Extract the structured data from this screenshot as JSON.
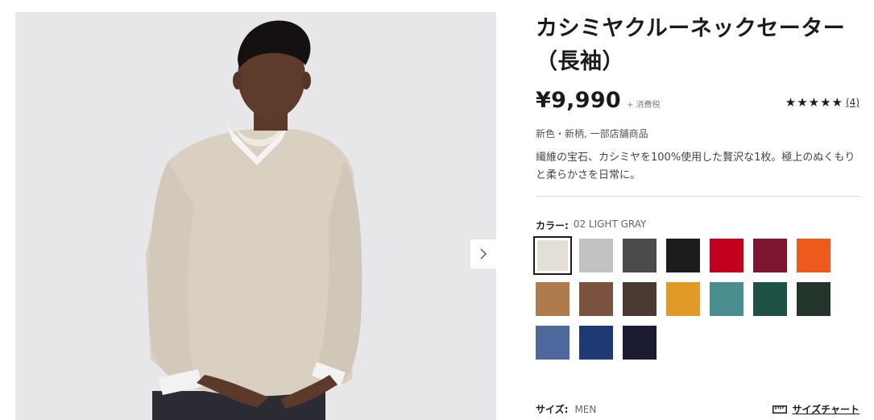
{
  "product": {
    "title": "カシミヤクルーネックセーター（長袖）",
    "price": "¥9,990",
    "tax_note": "+ 消費税",
    "rating_stars": "★★★★★",
    "review_count": "(4)",
    "tags": "新色・新柄, 一部店舗商品",
    "description": "繊維の宝石、カシミヤを100%使用した贅沢な1枚。極上のぬくもりと柔らかさを日常に。"
  },
  "gallery": {
    "next_icon": "chevron-right-icon",
    "background": "#e6e6e8"
  },
  "color": {
    "label": "カラー:",
    "selected": "02 LIGHT GRAY",
    "swatches": [
      {
        "color": "#e3dfd8"
      },
      {
        "color": "#c2c2c2"
      },
      {
        "color": "#4b4b4b"
      },
      {
        "color": "#1d1b1b"
      },
      {
        "color": "#c1001e"
      },
      {
        "color": "#7e1530"
      },
      {
        "color": "#ec5b1d"
      },
      {
        "color": "#b07b4c"
      },
      {
        "color": "#7b5240"
      },
      {
        "color": "#4a3a31"
      },
      {
        "color": "#e19a27"
      },
      {
        "color": "#4a8d8f"
      },
      {
        "color": "#1f5146"
      },
      {
        "color": "#24362b"
      },
      {
        "color": "#4e679c"
      },
      {
        "color": "#1f3a72"
      },
      {
        "color": "#1b1c30"
      }
    ]
  },
  "size": {
    "label": "サイズ:",
    "value": "MEN",
    "chart_link": "サイズチャート",
    "chart_icon": "ruler-icon"
  }
}
